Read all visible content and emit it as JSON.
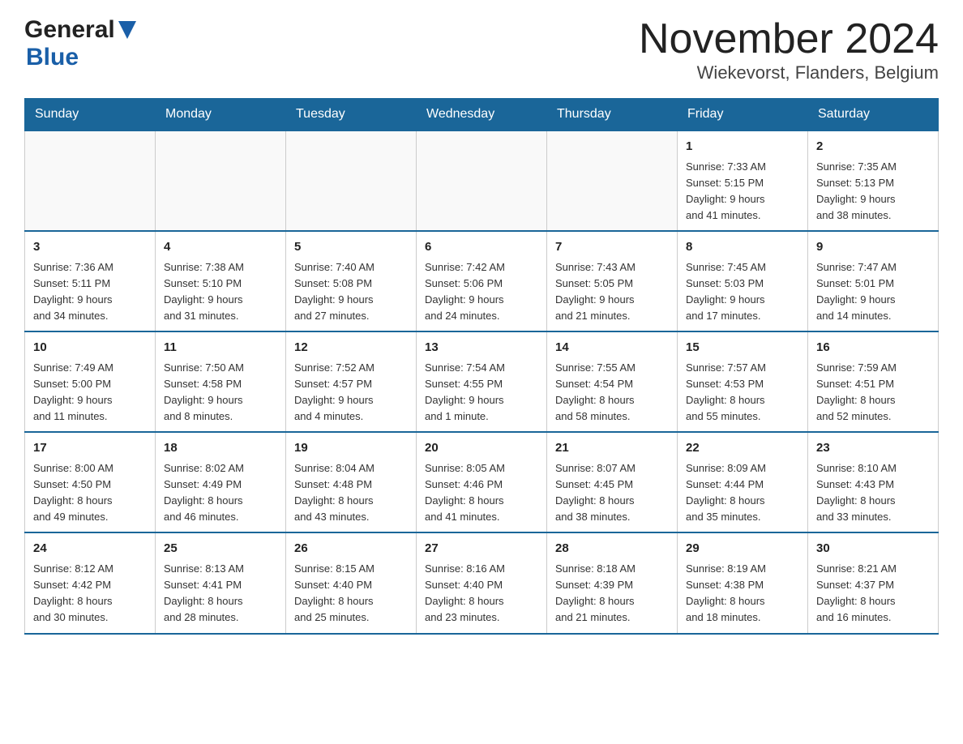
{
  "header": {
    "logo_general": "General",
    "logo_blue": "Blue",
    "month_title": "November 2024",
    "location": "Wiekevorst, Flanders, Belgium"
  },
  "weekdays": [
    "Sunday",
    "Monday",
    "Tuesday",
    "Wednesday",
    "Thursday",
    "Friday",
    "Saturday"
  ],
  "weeks": [
    {
      "days": [
        {
          "number": "",
          "info": ""
        },
        {
          "number": "",
          "info": ""
        },
        {
          "number": "",
          "info": ""
        },
        {
          "number": "",
          "info": ""
        },
        {
          "number": "",
          "info": ""
        },
        {
          "number": "1",
          "info": "Sunrise: 7:33 AM\nSunset: 5:15 PM\nDaylight: 9 hours\nand 41 minutes."
        },
        {
          "number": "2",
          "info": "Sunrise: 7:35 AM\nSunset: 5:13 PM\nDaylight: 9 hours\nand 38 minutes."
        }
      ]
    },
    {
      "days": [
        {
          "number": "3",
          "info": "Sunrise: 7:36 AM\nSunset: 5:11 PM\nDaylight: 9 hours\nand 34 minutes."
        },
        {
          "number": "4",
          "info": "Sunrise: 7:38 AM\nSunset: 5:10 PM\nDaylight: 9 hours\nand 31 minutes."
        },
        {
          "number": "5",
          "info": "Sunrise: 7:40 AM\nSunset: 5:08 PM\nDaylight: 9 hours\nand 27 minutes."
        },
        {
          "number": "6",
          "info": "Sunrise: 7:42 AM\nSunset: 5:06 PM\nDaylight: 9 hours\nand 24 minutes."
        },
        {
          "number": "7",
          "info": "Sunrise: 7:43 AM\nSunset: 5:05 PM\nDaylight: 9 hours\nand 21 minutes."
        },
        {
          "number": "8",
          "info": "Sunrise: 7:45 AM\nSunset: 5:03 PM\nDaylight: 9 hours\nand 17 minutes."
        },
        {
          "number": "9",
          "info": "Sunrise: 7:47 AM\nSunset: 5:01 PM\nDaylight: 9 hours\nand 14 minutes."
        }
      ]
    },
    {
      "days": [
        {
          "number": "10",
          "info": "Sunrise: 7:49 AM\nSunset: 5:00 PM\nDaylight: 9 hours\nand 11 minutes."
        },
        {
          "number": "11",
          "info": "Sunrise: 7:50 AM\nSunset: 4:58 PM\nDaylight: 9 hours\nand 8 minutes."
        },
        {
          "number": "12",
          "info": "Sunrise: 7:52 AM\nSunset: 4:57 PM\nDaylight: 9 hours\nand 4 minutes."
        },
        {
          "number": "13",
          "info": "Sunrise: 7:54 AM\nSunset: 4:55 PM\nDaylight: 9 hours\nand 1 minute."
        },
        {
          "number": "14",
          "info": "Sunrise: 7:55 AM\nSunset: 4:54 PM\nDaylight: 8 hours\nand 58 minutes."
        },
        {
          "number": "15",
          "info": "Sunrise: 7:57 AM\nSunset: 4:53 PM\nDaylight: 8 hours\nand 55 minutes."
        },
        {
          "number": "16",
          "info": "Sunrise: 7:59 AM\nSunset: 4:51 PM\nDaylight: 8 hours\nand 52 minutes."
        }
      ]
    },
    {
      "days": [
        {
          "number": "17",
          "info": "Sunrise: 8:00 AM\nSunset: 4:50 PM\nDaylight: 8 hours\nand 49 minutes."
        },
        {
          "number": "18",
          "info": "Sunrise: 8:02 AM\nSunset: 4:49 PM\nDaylight: 8 hours\nand 46 minutes."
        },
        {
          "number": "19",
          "info": "Sunrise: 8:04 AM\nSunset: 4:48 PM\nDaylight: 8 hours\nand 43 minutes."
        },
        {
          "number": "20",
          "info": "Sunrise: 8:05 AM\nSunset: 4:46 PM\nDaylight: 8 hours\nand 41 minutes."
        },
        {
          "number": "21",
          "info": "Sunrise: 8:07 AM\nSunset: 4:45 PM\nDaylight: 8 hours\nand 38 minutes."
        },
        {
          "number": "22",
          "info": "Sunrise: 8:09 AM\nSunset: 4:44 PM\nDaylight: 8 hours\nand 35 minutes."
        },
        {
          "number": "23",
          "info": "Sunrise: 8:10 AM\nSunset: 4:43 PM\nDaylight: 8 hours\nand 33 minutes."
        }
      ]
    },
    {
      "days": [
        {
          "number": "24",
          "info": "Sunrise: 8:12 AM\nSunset: 4:42 PM\nDaylight: 8 hours\nand 30 minutes."
        },
        {
          "number": "25",
          "info": "Sunrise: 8:13 AM\nSunset: 4:41 PM\nDaylight: 8 hours\nand 28 minutes."
        },
        {
          "number": "26",
          "info": "Sunrise: 8:15 AM\nSunset: 4:40 PM\nDaylight: 8 hours\nand 25 minutes."
        },
        {
          "number": "27",
          "info": "Sunrise: 8:16 AM\nSunset: 4:40 PM\nDaylight: 8 hours\nand 23 minutes."
        },
        {
          "number": "28",
          "info": "Sunrise: 8:18 AM\nSunset: 4:39 PM\nDaylight: 8 hours\nand 21 minutes."
        },
        {
          "number": "29",
          "info": "Sunrise: 8:19 AM\nSunset: 4:38 PM\nDaylight: 8 hours\nand 18 minutes."
        },
        {
          "number": "30",
          "info": "Sunrise: 8:21 AM\nSunset: 4:37 PM\nDaylight: 8 hours\nand 16 minutes."
        }
      ]
    }
  ]
}
